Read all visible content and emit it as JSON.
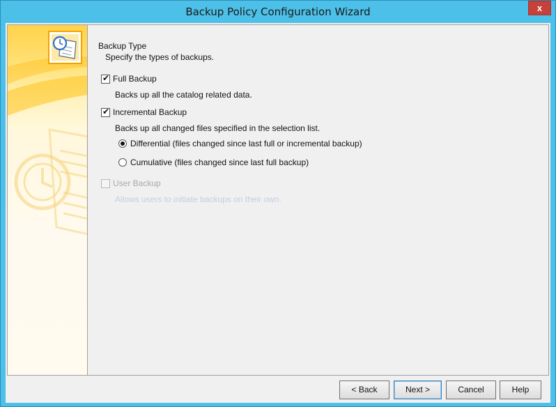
{
  "window": {
    "title": "Backup Policy Configuration Wizard",
    "close_glyph": "x"
  },
  "section": {
    "title": "Backup Type",
    "subtitle": "Specify the types of backups."
  },
  "options": {
    "full": {
      "label": "Full Backup",
      "checked": true,
      "description": "Backs up all the catalog related data."
    },
    "incremental": {
      "label": "Incremental Backup",
      "checked": true,
      "description": "Backs up all changed files specified in the selection list.",
      "differential": {
        "label": "Differential (files changed since last full or incremental backup)",
        "selected": true
      },
      "cumulative": {
        "label": "Cumulative (files changed since last full backup)",
        "selected": false
      }
    },
    "user": {
      "label": "User Backup",
      "checked": false,
      "disabled": true,
      "description": "Allows users to initiate backups on their own."
    }
  },
  "buttons": {
    "back": "< Back",
    "next": "Next >",
    "cancel": "Cancel",
    "help": "Help"
  },
  "colors": {
    "titlebar": "#4cc0e8",
    "close": "#c7403a",
    "sidebar_accent": "#ffd24a"
  },
  "icons": {
    "wizard": "backup-clock-document-icon",
    "watermark": "clock-document-watermark"
  }
}
